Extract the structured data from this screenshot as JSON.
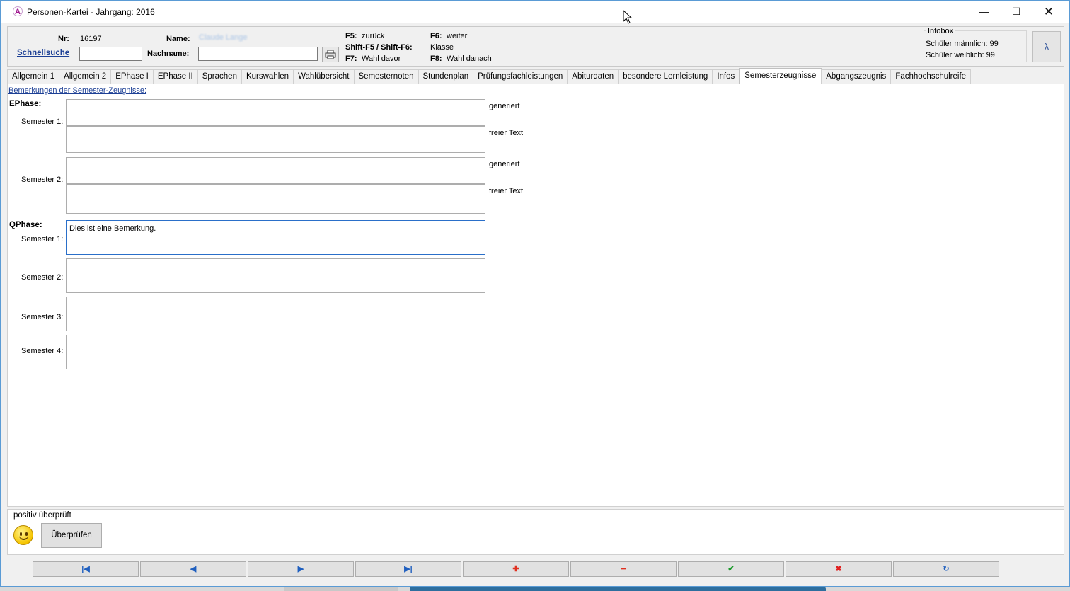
{
  "window": {
    "title": "Personen-Kartei - Jahrgang: 2016",
    "minimize_icon": "minimize-icon",
    "maximize_icon": "maximize-icon",
    "close_icon": "close-icon"
  },
  "header": {
    "nr_label": "Nr:",
    "nr_value": "16197",
    "name_label": "Name:",
    "name_value": "Claude Lange",
    "quicksearch_link": "Schnellsuche",
    "quicksearch_value": "",
    "lastname_label": "Nachname:",
    "lastname_value": "",
    "print_icon": "printer-icon",
    "shortcuts": [
      {
        "key": "F5:",
        "action": "zurück"
      },
      {
        "key": "F6:",
        "action": "weiter"
      },
      {
        "key": "Shift-F5 / Shift-F6:",
        "action": "Klasse"
      },
      {
        "key": "F7:",
        "action": "Wahl davor"
      },
      {
        "key": "F8:",
        "action": "Wahl danach"
      }
    ],
    "infobox": {
      "title": "Infobox",
      "line1": "Schüler männlich: 99",
      "line2": "Schüler weiblich: 99"
    },
    "help_icon": "lambda-help-icon"
  },
  "tabs": [
    {
      "label": "Allgemein 1"
    },
    {
      "label": "Allgemein 2"
    },
    {
      "label": "EPhase I"
    },
    {
      "label": "EPhase II"
    },
    {
      "label": "Sprachen"
    },
    {
      "label": "Kurswahlen"
    },
    {
      "label": "Wahlübersicht"
    },
    {
      "label": "Semesternoten"
    },
    {
      "label": "Stundenplan"
    },
    {
      "label": "Prüfungsfachleistungen"
    },
    {
      "label": "Abiturdaten"
    },
    {
      "label": "besondere Lernleistung"
    },
    {
      "label": "Infos"
    },
    {
      "label": "Semesterzeugnisse",
      "active": true
    },
    {
      "label": "Abgangszeugnis"
    },
    {
      "label": "Fachhochschulreife"
    }
  ],
  "main": {
    "section_title": "Bemerkungen der Semester-Zeugnisse:",
    "ephase": {
      "label": "EPhase:",
      "sem1_label": "Semester 1:",
      "sem2_label": "Semester 2:",
      "generated_label": "generiert",
      "free_text_label": "freier Text",
      "sem1_generated": "",
      "sem1_free": "",
      "sem2_generated": "",
      "sem2_free": ""
    },
    "qphase": {
      "label": "QPhase:",
      "sem1_label": "Semester 1:",
      "sem2_label": "Semester 2:",
      "sem3_label": "Semester 3:",
      "sem4_label": "Semester 4:",
      "sem1_text": "Dies ist eine Bemerkung.",
      "sem2_text": "",
      "sem3_text": "",
      "sem4_text": ""
    }
  },
  "status": {
    "text": "positiv überprüft",
    "smiley_icon": "smiley-icon",
    "check_button": "Überprüfen"
  },
  "navigation": {
    "first": {
      "icon": "first-record-icon",
      "glyph": "|◀",
      "color": "#1f5fbf"
    },
    "prev": {
      "icon": "previous-record-icon",
      "glyph": "◀",
      "color": "#1f5fbf"
    },
    "next": {
      "icon": "next-record-icon",
      "glyph": "▶",
      "color": "#1f5fbf"
    },
    "last": {
      "icon": "last-record-icon",
      "glyph": "▶|",
      "color": "#1f5fbf"
    },
    "add": {
      "icon": "add-icon",
      "glyph": "✚",
      "color": "#e03020"
    },
    "remove": {
      "icon": "remove-icon",
      "glyph": "━",
      "color": "#e03020"
    },
    "confirm": {
      "icon": "checkmark-icon",
      "glyph": "✔",
      "color": "#1a9a2a"
    },
    "cancel": {
      "icon": "cancel-icon",
      "glyph": "✖",
      "color": "#e02020"
    },
    "refresh": {
      "icon": "refresh-icon",
      "glyph": "↻",
      "color": "#1f5fbf"
    }
  }
}
